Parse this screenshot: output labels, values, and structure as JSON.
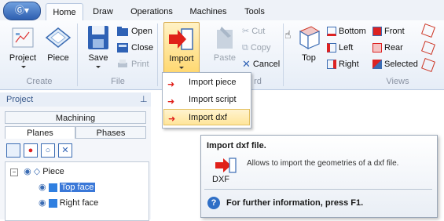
{
  "app_button": {
    "icon": "app-menu-icon",
    "glyph": "Ⓖ▾"
  },
  "tabs": [
    {
      "label": "Home",
      "active": true
    },
    {
      "label": "Draw"
    },
    {
      "label": "Operations"
    },
    {
      "label": "Machines"
    },
    {
      "label": "Tools"
    }
  ],
  "ribbon": {
    "create": {
      "group_label": "Create",
      "project": "Project",
      "piece": "Piece"
    },
    "file": {
      "group_label": "File",
      "save": "Save",
      "open": "Open",
      "close": "Close",
      "print": "Print"
    },
    "import": {
      "label": "Import"
    },
    "clipboard": {
      "group_label_partial": "rd",
      "paste": "Paste",
      "cut": "Cut",
      "copy": "Copy",
      "cancel": "Cancel"
    },
    "views": {
      "group_label": "Views",
      "top": "Top",
      "bottom": "Bottom",
      "left": "Left",
      "right": "Right",
      "front": "Front",
      "rear": "Rear",
      "selected": "Selected"
    }
  },
  "import_menu": {
    "items": [
      {
        "label": "Import piece",
        "icon": "import-piece-icon"
      },
      {
        "label": "Import script",
        "icon": "import-script-icon"
      },
      {
        "label": "Import dxf",
        "icon": "import-dxf-icon",
        "highlighted": true
      }
    ]
  },
  "project_panel": {
    "title": "Project",
    "pin_icon": "pin-icon",
    "tabs": {
      "machining": "Machining",
      "planes": "Planes",
      "phases": "Phases"
    },
    "tree": [
      {
        "label": "Piece",
        "level": 0,
        "expanded": true
      },
      {
        "label": "Top face",
        "level": 1,
        "selected": true
      },
      {
        "label": "Right face",
        "level": 1
      }
    ]
  },
  "tooltip": {
    "title": "Import dxf file.",
    "icon_label": "DXF",
    "description": "Allows to import the geometries of a dxf file.",
    "help": "For further information, press F1."
  },
  "colors": {
    "accent": "#2d5fb0",
    "highlight": "#ffe59a",
    "import_red": "#e0201a"
  }
}
